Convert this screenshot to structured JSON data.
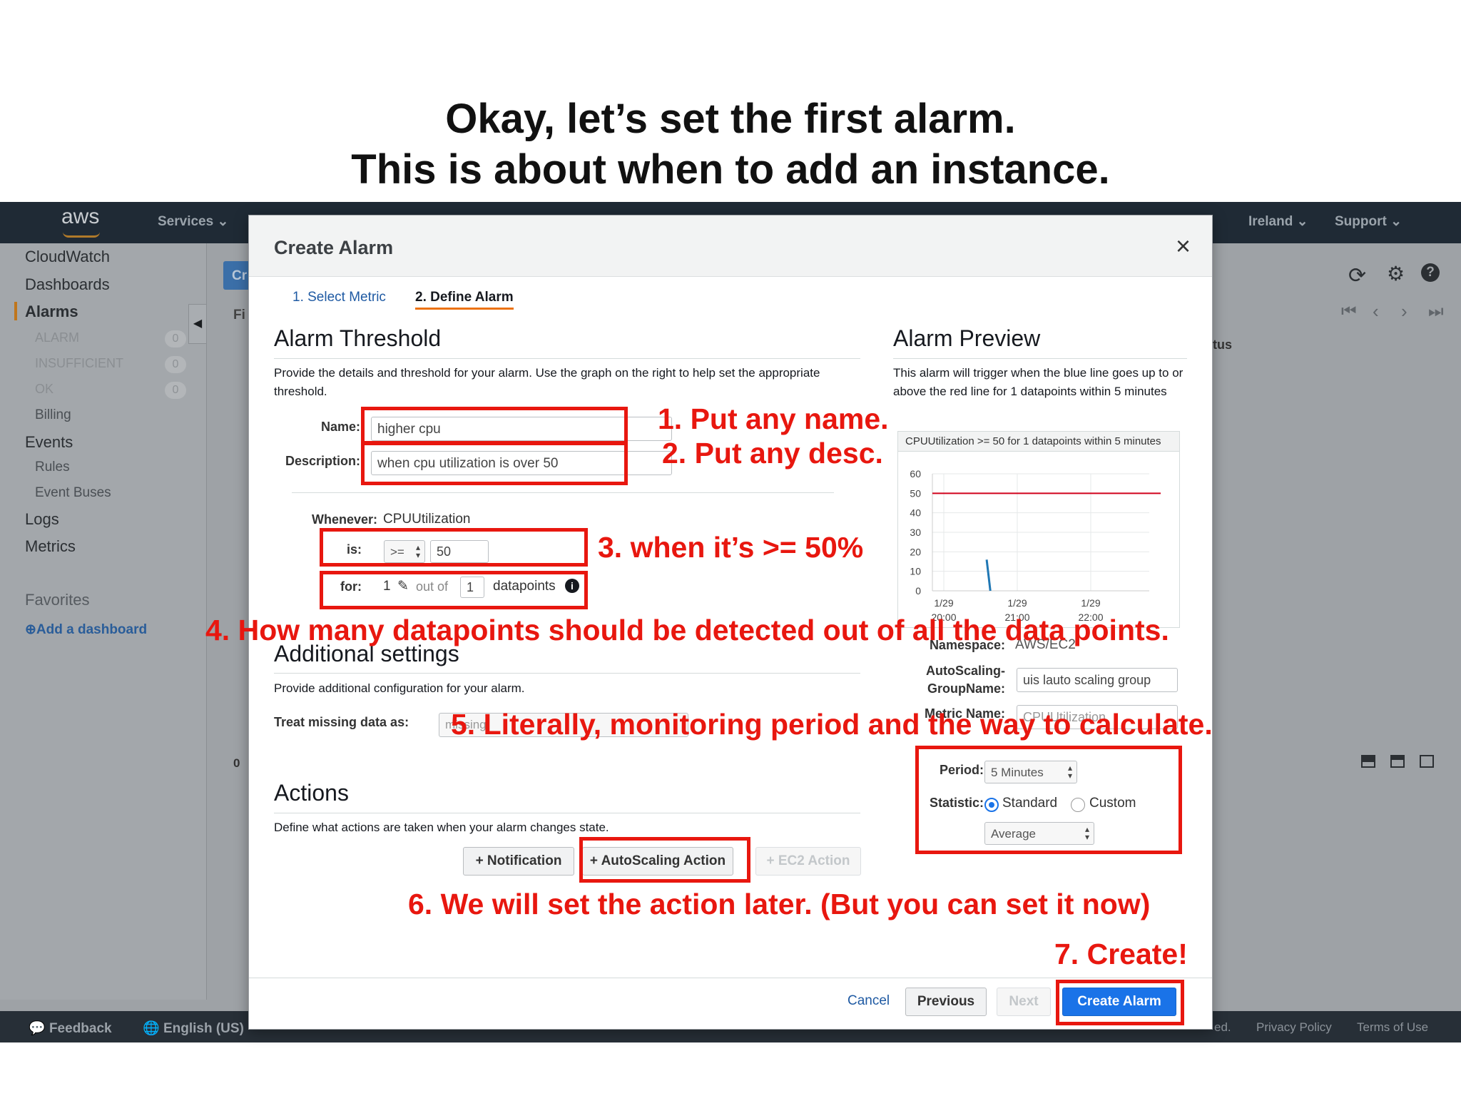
{
  "slide": {
    "title_line1": "Okay, let’s set the first alarm.",
    "title_line2": "This is about when to add an instance."
  },
  "topnav": {
    "logo": "aws",
    "services": "Services",
    "region": "Ireland",
    "support": "Support"
  },
  "sidebar": {
    "cloudwatch": "CloudWatch",
    "dashboards": "Dashboards",
    "alarms": "Alarms",
    "alarm_states": [
      {
        "label": "ALARM",
        "count": "0"
      },
      {
        "label": "INSUFFICIENT",
        "count": "0"
      },
      {
        "label": "OK",
        "count": "0"
      }
    ],
    "billing": "Billing",
    "events": "Events",
    "rules": "Rules",
    "event_buses": "Event Buses",
    "logs": "Logs",
    "metrics": "Metrics",
    "favorites": "Favorites",
    "add_dashboard": "Add a dashboard"
  },
  "background": {
    "tab_fragment": "Cr",
    "filter_fragment": "Fi",
    "status_fragment": "tus",
    "count_fragment": "0"
  },
  "bottombar": {
    "feedback": "Feedback",
    "language": "English (US)",
    "copyright_fragment": "ed.",
    "privacy": "Privacy Policy",
    "terms": "Terms of Use"
  },
  "modal": {
    "title": "Create Alarm",
    "close": "×",
    "steps": [
      "1. Select Metric",
      "2. Define Alarm"
    ],
    "threshold": {
      "heading": "Alarm Threshold",
      "desc": "Provide the details and threshold for your alarm. Use the graph on the right to help set the appropriate threshold.",
      "name_label": "Name:",
      "name_value": "higher cpu",
      "description_label": "Description:",
      "description_value": "when cpu utilization is over 50",
      "whenever_label": "Whenever:",
      "whenever_value": "CPUUtilization",
      "is_label": "is:",
      "operator": ">=",
      "threshold_value": "50",
      "for_label": "for:",
      "for_value": "1",
      "out_of": "out of",
      "out_of_value": "1",
      "datapoints": "datapoints"
    },
    "additional": {
      "heading": "Additional settings",
      "desc": "Provide additional configuration for your alarm.",
      "missing_label": "Treat missing data as:",
      "missing_value": "missing"
    },
    "actions": {
      "heading": "Actions",
      "desc": "Define what actions are taken when your alarm changes state.",
      "notification": "+ Notification",
      "autoscaling": "+ AutoScaling Action",
      "ec2": "+ EC2 Action"
    },
    "preview": {
      "heading": "Alarm Preview",
      "desc": "This alarm will trigger when the blue line goes up to or above the red line for 1 datapoints within 5 minutes",
      "chart_title": "CPUUtilization >= 50 for 1 datapoints within 5 minutes",
      "namespace_label": "Namespace:",
      "namespace_value": "AWS/EC2",
      "asg_label_1": "AutoScaling-",
      "asg_label_2": "GroupName:",
      "asg_value": "uis lauto scaling group",
      "metric_label": "Metric Name:",
      "metric_value": "CPUUtilization",
      "period_label": "Period:",
      "period_value": "5 Minutes",
      "statistic_label": "Statistic:",
      "standard": "Standard",
      "custom": "Custom",
      "statistic_value": "Average"
    },
    "footer": {
      "cancel": "Cancel",
      "previous": "Previous",
      "next": "Next",
      "create": "Create Alarm"
    }
  },
  "annotations": {
    "a1": "1. Put any name.",
    "a2": "2. Put any desc.",
    "a3": "3. when it’s >= 50%",
    "a4": "4. How many datapoints should be detected out of all the data points.",
    "a5": "5. Literally, monitoring period  and the way to calculate.",
    "a6": "6. We will set the action later. (But you can set it now)",
    "a7": "7. Create!"
  },
  "colors": {
    "annotation": "#e8170f",
    "accent": "#1a73e8",
    "threshold_line": "#d0021b",
    "metric_line": "#1f77b4"
  },
  "chart_data": {
    "type": "line",
    "title": "CPUUtilization >= 50 for 1 datapoints within 5 minutes",
    "x_ticks": [
      [
        "1/29",
        "20:00"
      ],
      [
        "1/29",
        "21:00"
      ],
      [
        "1/29",
        "22:00"
      ]
    ],
    "y_ticks": [
      60,
      50,
      40,
      30,
      20,
      10,
      0
    ],
    "ylim": [
      0,
      60
    ],
    "threshold": 50,
    "series": [
      {
        "x": [
          "20:35",
          "20:38"
        ],
        "y": [
          16,
          0
        ]
      }
    ],
    "grid": true
  }
}
